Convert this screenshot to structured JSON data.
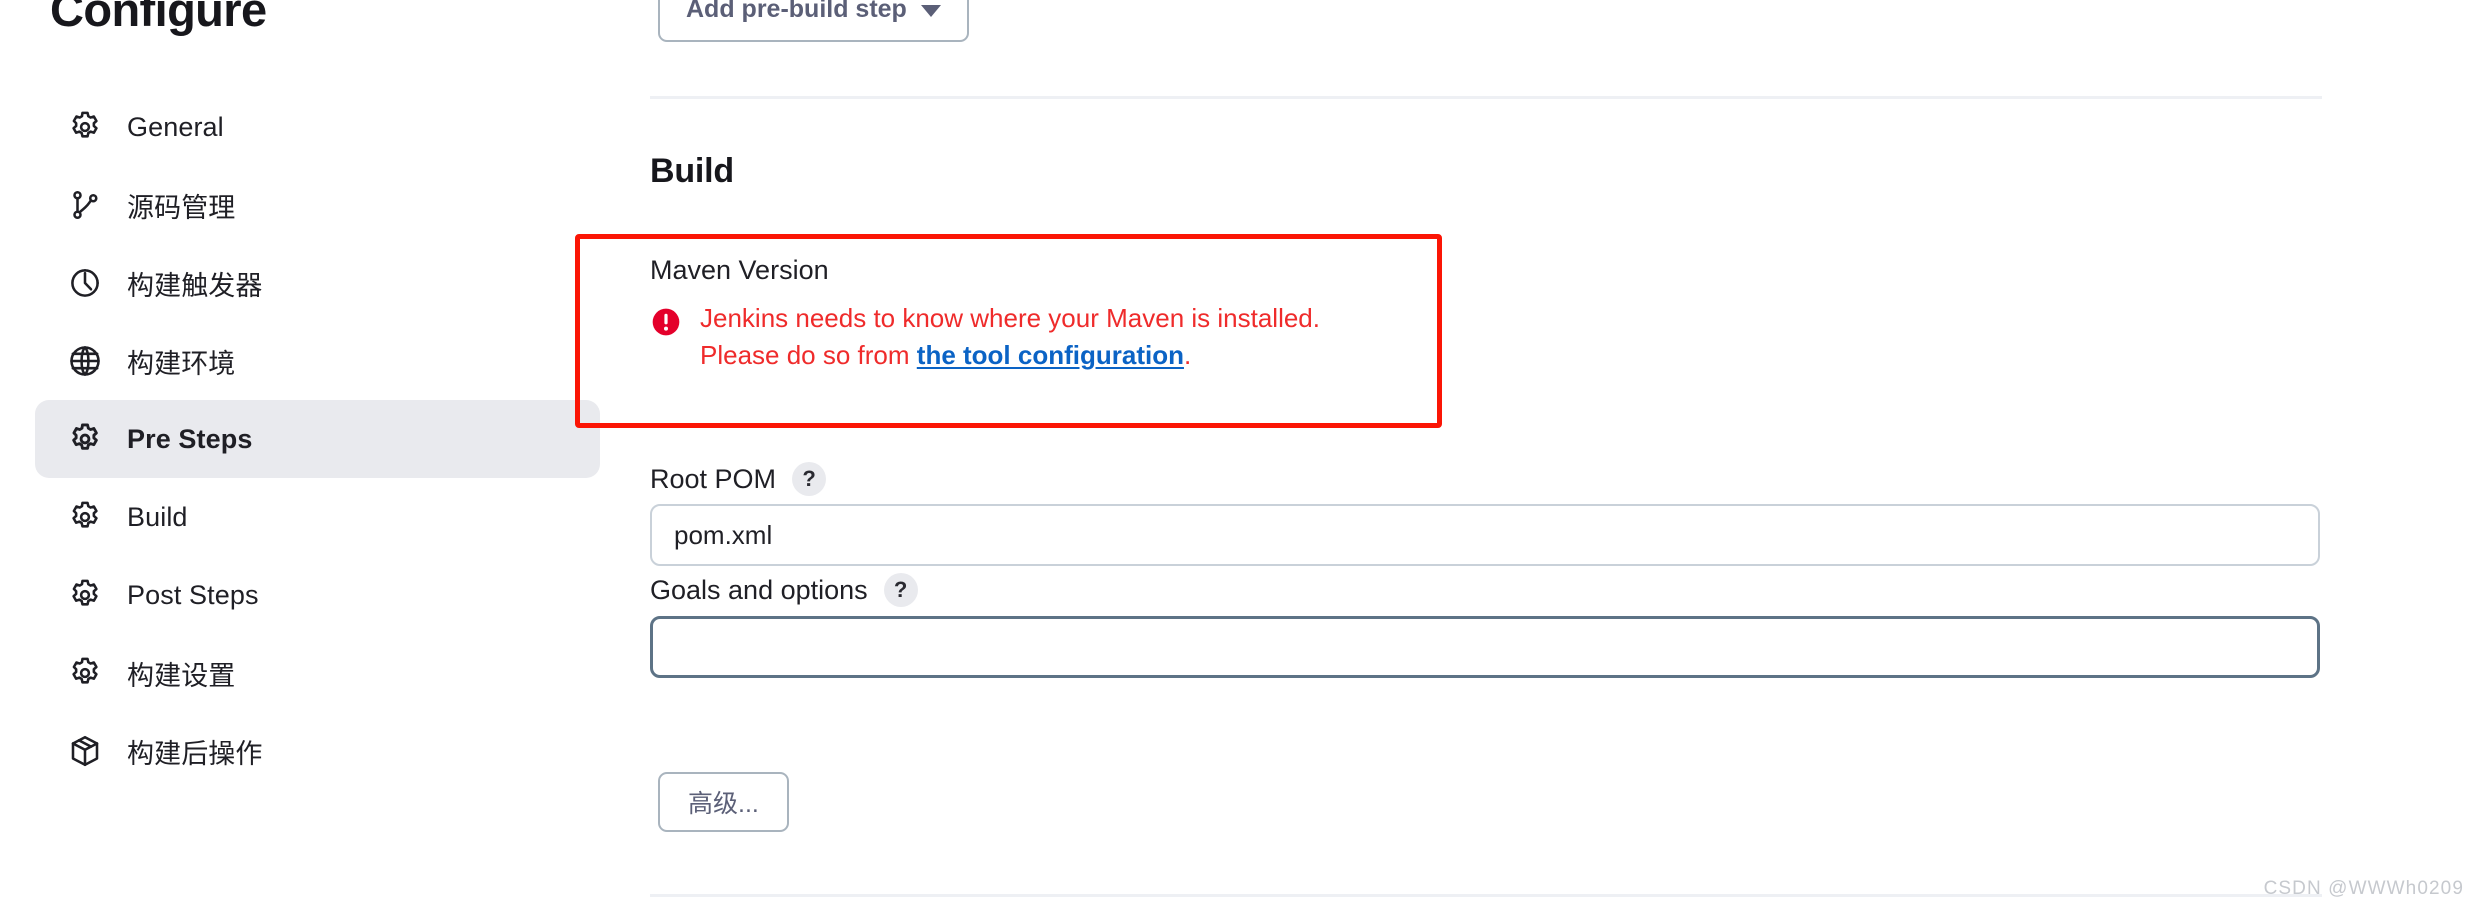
{
  "sidebar": {
    "title": "Configure",
    "items": [
      {
        "label": "General",
        "icon": "gear-icon",
        "active": false
      },
      {
        "label": "源码管理",
        "icon": "git-branch-icon",
        "active": false
      },
      {
        "label": "构建触发器",
        "icon": "clock-icon",
        "active": false
      },
      {
        "label": "构建环境",
        "icon": "globe-icon",
        "active": false
      },
      {
        "label": "Pre Steps",
        "icon": "gear-icon",
        "active": true
      },
      {
        "label": "Build",
        "icon": "gear-icon",
        "active": false
      },
      {
        "label": "Post Steps",
        "icon": "gear-icon",
        "active": false
      },
      {
        "label": "构建设置",
        "icon": "gear-icon",
        "active": false
      },
      {
        "label": "构建后操作",
        "icon": "package-icon",
        "active": false
      }
    ]
  },
  "main": {
    "add_pre_build_step_label": "Add pre-build step",
    "add_pre_build_step_icon": "chevron-down-icon",
    "section_title": "Build",
    "maven_version_label": "Maven Version",
    "error": {
      "icon": "error-circle-icon",
      "line1": "Jenkins needs to know where your Maven is installed.",
      "line2_prefix": "Please do so from ",
      "link_text": "the tool configuration",
      "line2_suffix": "."
    },
    "root_pom_label": "Root POM",
    "root_pom_help": "?",
    "root_pom_value": "pom.xml",
    "goals_label": "Goals and options",
    "goals_help": "?",
    "goals_value": "",
    "goals_placeholder": "",
    "advanced_label": "高级..."
  },
  "annotation": {
    "highlight_color": "#fb1505"
  },
  "watermark": {
    "text": "CSDN @WWWh0209"
  }
}
